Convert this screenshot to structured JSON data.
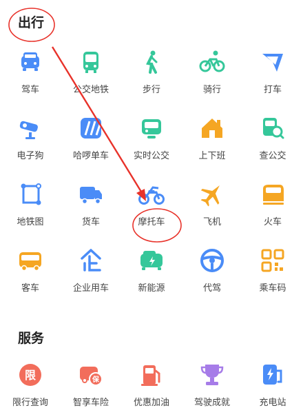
{
  "travel": {
    "title": "出行",
    "items": [
      {
        "label": "驾车",
        "icon": "car-icon",
        "color": "#4a8cf7"
      },
      {
        "label": "公交地铁",
        "icon": "bus-icon",
        "color": "#35c79a"
      },
      {
        "label": "步行",
        "icon": "walk-icon",
        "color": "#35c79a"
      },
      {
        "label": "骑行",
        "icon": "bike-icon",
        "color": "#35c79a"
      },
      {
        "label": "打车",
        "icon": "taxi-icon",
        "color": "#4a8cf7"
      },
      {
        "label": "电子狗",
        "icon": "camera-icon",
        "color": "#4a8cf7"
      },
      {
        "label": "哈啰单车",
        "icon": "hello-bike-icon",
        "color": "#4a8cf7"
      },
      {
        "label": "实时公交",
        "icon": "realtime-bus-icon",
        "color": "#35c79a"
      },
      {
        "label": "上下班",
        "icon": "commute-icon",
        "color": "#f5a623"
      },
      {
        "label": "查公交",
        "icon": "search-bus-icon",
        "color": "#35c79a"
      },
      {
        "label": "地铁图",
        "icon": "metro-map-icon",
        "color": "#4a8cf7"
      },
      {
        "label": "货车",
        "icon": "truck-icon",
        "color": "#4a8cf7"
      },
      {
        "label": "摩托车",
        "icon": "motorcycle-icon",
        "color": "#4a8cf7"
      },
      {
        "label": "飞机",
        "icon": "airplane-icon",
        "color": "#f5a623"
      },
      {
        "label": "火车",
        "icon": "train-icon",
        "color": "#f5a623"
      },
      {
        "label": "客车",
        "icon": "coach-icon",
        "color": "#f5a623"
      },
      {
        "label": "企业用车",
        "icon": "enterprise-car-icon",
        "color": "#4a8cf7"
      },
      {
        "label": "新能源",
        "icon": "new-energy-icon",
        "color": "#35c79a"
      },
      {
        "label": "代驾",
        "icon": "steering-wheel-icon",
        "color": "#4a8cf7"
      },
      {
        "label": "乘车码",
        "icon": "ride-code-icon",
        "color": "#f5a623"
      }
    ]
  },
  "services": {
    "title": "服务",
    "items": [
      {
        "label": "限行查询",
        "icon": "restriction-icon",
        "color": "#f26d5b",
        "glyph": "限"
      },
      {
        "label": "智享车险",
        "icon": "insurance-icon",
        "color": "#f26d5b",
        "glyph": "保"
      },
      {
        "label": "优惠加油",
        "icon": "fuel-icon",
        "color": "#f26d5b"
      },
      {
        "label": "驾驶成就",
        "icon": "trophy-icon",
        "color": "#a67ce8"
      },
      {
        "label": "充电站",
        "icon": "charging-station-icon",
        "color": "#4a8cf7"
      }
    ]
  },
  "annotation_color": "#e8322a"
}
